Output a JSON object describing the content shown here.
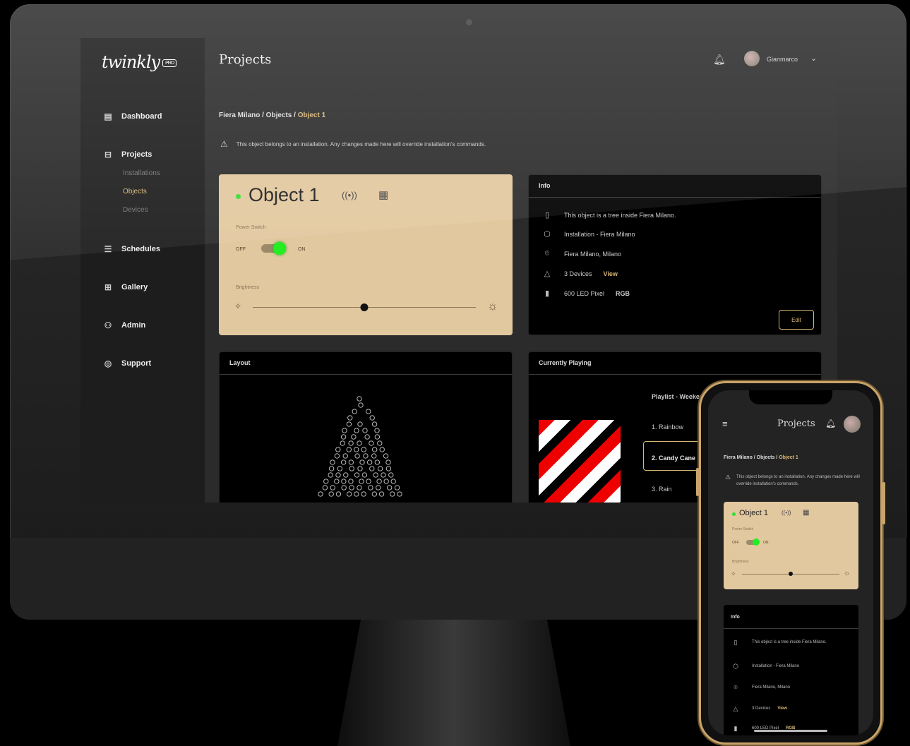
{
  "app": {
    "logo": "twinkly",
    "logo_badge": "PRO",
    "page_title": "Projects",
    "user_name": "Gianmarco"
  },
  "sidebar": {
    "items": [
      {
        "label": "Dashboard",
        "icon": "dashboard-icon"
      },
      {
        "label": "Projects",
        "icon": "projects-icon"
      },
      {
        "label": "Schedules",
        "icon": "schedules-icon"
      },
      {
        "label": "Gallery",
        "icon": "gallery-icon"
      },
      {
        "label": "Admin",
        "icon": "admin-icon"
      },
      {
        "label": "Support",
        "icon": "support-icon"
      }
    ],
    "sub_items": [
      "Installations",
      "Objects",
      "Devices"
    ],
    "active_sub": "Objects"
  },
  "breadcrumb": {
    "path": "Fiera Milano / Objects / ",
    "current": "Object 1"
  },
  "warning": "This object belongs to an installation. Any changes made here will override installation's commands.",
  "object_card": {
    "title": "Object 1",
    "status_color": "#33dd33",
    "power_label": "Power Switch",
    "off_label": "OFF",
    "on_label": "ON",
    "power_on": true,
    "brightness_label": "Brightness",
    "brightness": 0.5
  },
  "info_card": {
    "title": "Info",
    "rows": [
      {
        "icon": "document-icon",
        "text": "This object is a tree inside Fiera Milano."
      },
      {
        "icon": "installation-icon",
        "text": "Installation - Fiera Milano"
      },
      {
        "icon": "location-pin-icon",
        "text": "Fiera Milano, Milano"
      },
      {
        "icon": "devices-icon",
        "text": "3 Devices",
        "extra": "View"
      },
      {
        "icon": "led-icon",
        "text": "600 LED Pixel",
        "extra": "RGB"
      }
    ],
    "edit_label": "Edit"
  },
  "layout_card": {
    "title": "Layout"
  },
  "playing_card": {
    "title": "Currently Playing",
    "playlist_label": "Playlist - Weekend",
    "items": [
      "1. Rainbow",
      "2. Candy Cane",
      "3. Rain"
    ],
    "active_index": 1
  },
  "phone": {
    "title": "Projects",
    "breadcrumb_path": "Fiera Milano / Objects / ",
    "breadcrumb_current": "Object 1",
    "warning": "This object belongs to an installation. Any changes made here will override installation's commands.",
    "object_title": "Object 1",
    "power_label": "Power Switch",
    "off_label": "OFF",
    "on_label": "ON",
    "brightness_label": "Brightness",
    "brightness": 0.5,
    "info_title": "Info",
    "info_rows": [
      {
        "icon": "document-icon",
        "text": "This object is a tree inside Fiera Milano."
      },
      {
        "icon": "installation-icon",
        "text": "Installation - Fiera Milano"
      },
      {
        "icon": "location-pin-icon",
        "text": "Fiera Milano, Milano"
      },
      {
        "icon": "devices-icon",
        "text": "3 Devices",
        "extra": "View"
      },
      {
        "icon": "led-icon",
        "text": "600 LED Pixel",
        "extra": "RGB"
      }
    ]
  },
  "colors": {
    "accent": "#d8b778",
    "card": "#e2c89f",
    "status_on": "#33dd33"
  }
}
